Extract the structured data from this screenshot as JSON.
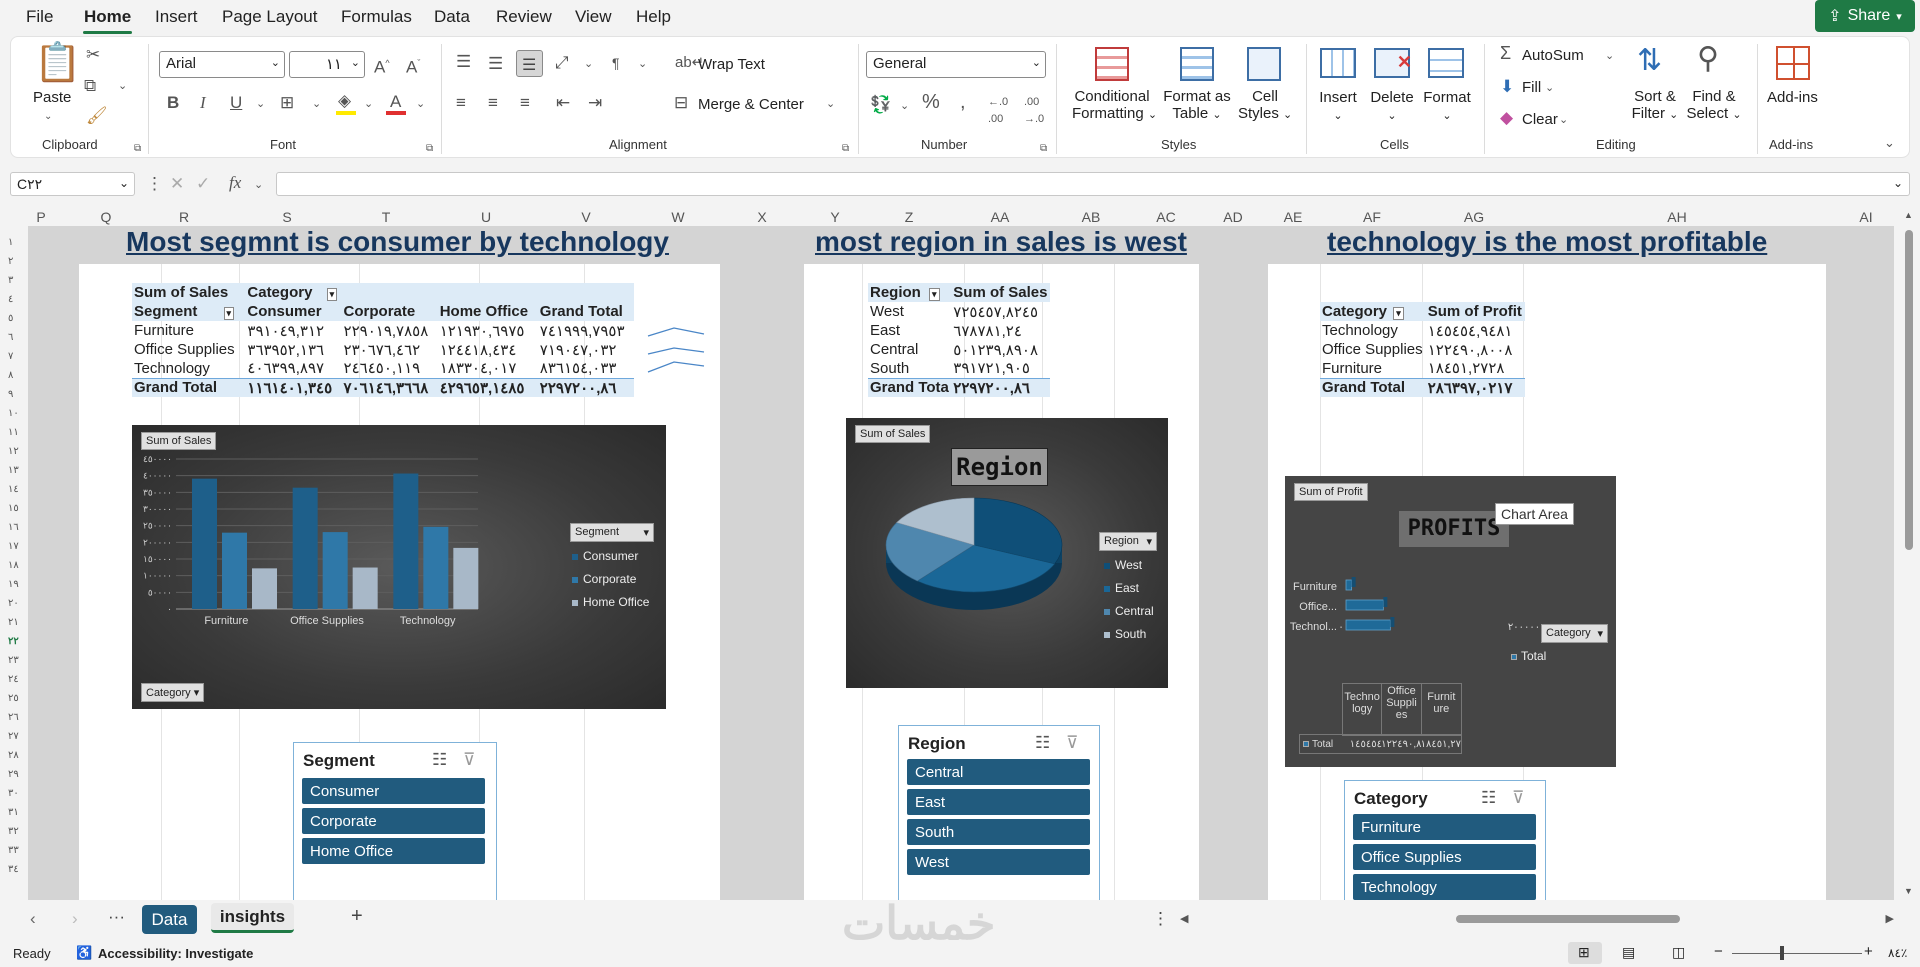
{
  "menu": {
    "tabs": [
      "File",
      "Home",
      "Insert",
      "Page Layout",
      "Formulas",
      "Data",
      "Review",
      "View",
      "Help"
    ],
    "active": "Home",
    "share": "Share"
  },
  "ribbon": {
    "clipboard": {
      "paste": "Paste",
      "label": "Clipboard"
    },
    "font": {
      "name": "Arial",
      "size": "١١",
      "label": "Font"
    },
    "alignment": {
      "wrap": "Wrap Text",
      "merge": "Merge & Center",
      "label": "Alignment"
    },
    "number": {
      "format": "General",
      "label": "Number"
    },
    "styles": {
      "conditional": [
        "Conditional",
        "Formatting"
      ],
      "format_table": [
        "Format as",
        "Table"
      ],
      "cell_styles": [
        "Cell",
        "Styles"
      ],
      "label": "Styles"
    },
    "cells": {
      "insert": "Insert",
      "delete": "Delete",
      "format": "Format",
      "label": "Cells"
    },
    "editing": {
      "autosum": "AutoSum",
      "fill": "Fill",
      "clear": "Clear",
      "sort": [
        "Sort &",
        "Filter"
      ],
      "find": [
        "Find &",
        "Select"
      ],
      "label": "Editing"
    },
    "addins": {
      "addins": "Add-ins",
      "label": "Add-ins"
    }
  },
  "formula_bar": {
    "name_box": "C٢٢",
    "fx": "fx",
    "value": ""
  },
  "columns": [
    "P",
    "Q",
    "R",
    "S",
    "T",
    "U",
    "V",
    "W",
    "X",
    "Y",
    "Z",
    "AA",
    "AB",
    "AC",
    "AD",
    "AE",
    "AF",
    "AG",
    "AH",
    "AI"
  ],
  "rows": [
    "١",
    "٢",
    "٣",
    "٤",
    "٥",
    "٦",
    "٧",
    "٨",
    "٩",
    "١٠",
    "١١",
    "١٢",
    "١٣",
    "١٤",
    "١٥",
    "١٦",
    "١٧",
    "١٨",
    "١٩",
    "٢٠",
    "٢١",
    "٢٢",
    "٢٣",
    "٢٤",
    "٢٥",
    "٢٦",
    "٢٧",
    "٢٨",
    "٢٩",
    "٣٠",
    "٣١",
    "٣٢",
    "٣٣",
    "٣٤"
  ],
  "panel1": {
    "title": "Most segmnt is consumer by technology",
    "pivot": {
      "corner": "Sum of Sales",
      "col_field": "Category",
      "row_field": "Segment",
      "headers": [
        "Consumer",
        "Corporate",
        "Home Office",
        "Grand Total"
      ],
      "rows": [
        {
          "label": "Furniture",
          "values": [
            "٣٩١٠٤٩,٣١٢",
            "٢٢٩٠١٩,٧٨٥٨",
            "١٢١٩٣٠,٦٩٧٥",
            "٧٤١٩٩٩,٧٩٥٣"
          ]
        },
        {
          "label": "Office Supplies",
          "values": [
            "٣٦٣٩٥٢,١٣٦",
            "٢٣٠٦٧٦,٤٦٢",
            "١٢٤٤١٨,٤٣٤",
            "٧١٩٠٤٧,٠٣٢"
          ]
        },
        {
          "label": "Technology",
          "values": [
            "٤٠٦٣٩٩,٨٩٧",
            "٢٤٦٤٥٠,١١٩",
            "١٨٣٣٠٤,٠١٧",
            "٨٣٦١٥٤,٠٣٣"
          ]
        }
      ],
      "total_label": "Grand Total",
      "totals": [
        "١١٦١٤٠١,٣٤٥",
        "٧٠٦١٤٦,٣٦٦٨",
        "٤٢٩٦٥٣,١٤٨٥",
        "٢٢٩٧٢٠٠,٨٦"
      ]
    },
    "chart": {
      "field_button": "Sum of Sales",
      "axis_button": "Category",
      "legend_button": "Segment",
      "legend": [
        "Consumer",
        "Corporate",
        "Home Office"
      ],
      "y_ticks": [
        "٤٥٠٠٠٠",
        "٤٠٠٠٠٠",
        "٣٥٠٠٠٠",
        "٣٠٠٠٠٠",
        "٢٥٠٠٠٠",
        "٢٠٠٠٠٠",
        "١٥٠٠٠٠",
        "١٠٠٠٠٠",
        "٥٠٠٠٠",
        "٠"
      ]
    },
    "slicer": {
      "title": "Segment",
      "items": [
        "Consumer",
        "Corporate",
        "Home Office"
      ]
    }
  },
  "panel2": {
    "title": "most region in sales is west",
    "pivot": {
      "h1": "Region",
      "h2": "Sum of Sales",
      "rows": [
        {
          "label": "West",
          "value": "٧٢٥٤٥٧,٨٢٤٥"
        },
        {
          "label": "East",
          "value": "٦٧٨٧٨١,٢٤"
        },
        {
          "label": "Central",
          "value": "٥٠١٢٣٩,٨٩٠٨"
        },
        {
          "label": "South",
          "value": "٣٩١٧٢١,٩٠٥"
        }
      ],
      "total_label": "Grand Tota",
      "total": "٢٢٩٧٢٠٠,٨٦"
    },
    "chart": {
      "field_button": "Sum of Sales",
      "title": "Region",
      "legend_button": "Region",
      "legend": [
        "West",
        "East",
        "Central",
        "South"
      ]
    },
    "slicer": {
      "title": "Region",
      "items": [
        "Central",
        "East",
        "South",
        "West"
      ]
    }
  },
  "panel3": {
    "title": "technology is the most profitable",
    "pivot": {
      "h1": "Category",
      "h2": "Sum of Profit",
      "rows": [
        {
          "label": "Technology",
          "value": "١٤٥٤٥٤,٩٤٨١"
        },
        {
          "label": "Office Supplies",
          "value": "١٢٢٤٩٠,٨٠٠٨"
        },
        {
          "label": "Furniture",
          "value": "١٨٤٥١,٢٧٢٨"
        }
      ],
      "total_label": "Grand Total",
      "total": "٢٨٦٣٩٧,٠٢١٧"
    },
    "chart": {
      "field_button": "Sum of Profit",
      "title": "PROFITS",
      "tooltip": "Chart Area",
      "categories": [
        "Furniture",
        "Office...",
        "Technol..."
      ],
      "x_ticks": [
        "٠",
        "٢٠٠٠٠٠"
      ],
      "legend_button": "Category",
      "legend": "Total",
      "table_headers": [
        "Techno logy",
        "Office Suppli es",
        "Furnit ure"
      ],
      "table_row_label": "Total",
      "table_values": [
        "١٤٥٤٥٤",
        "١٢٢٤٩٠,٨",
        "١٨٤٥١,٢٧"
      ]
    },
    "slicer": {
      "title": "Category",
      "items": [
        "Furniture",
        "Office Supplies",
        "Technology"
      ]
    }
  },
  "sheet_tabs": {
    "tabs": [
      "Data",
      "insights"
    ],
    "active": "insights"
  },
  "status": {
    "ready": "Ready",
    "accessibility": "Accessibility: Investigate",
    "zoom": "٨٤٪",
    "watermark": "خمسات"
  },
  "chart_data": [
    {
      "type": "bar",
      "title": "",
      "categories": [
        "Furniture",
        "Office Supplies",
        "Technology"
      ],
      "series": [
        {
          "name": "Consumer",
          "values": [
            391049.312,
            363952.136,
            406399.897
          ]
        },
        {
          "name": "Corporate",
          "values": [
            229019.7858,
            230676.462,
            246450.119
          ]
        },
        {
          "name": "Home Office",
          "values": [
            121930.6975,
            124418.434,
            183304.017
          ]
        }
      ],
      "ylim": [
        0,
        450000
      ],
      "legend": "right"
    },
    {
      "type": "pie",
      "title": "Region",
      "categories": [
        "West",
        "East",
        "Central",
        "South"
      ],
      "values": [
        725457.8245,
        678781.24,
        501239.8908,
        391721.905
      ],
      "legend": "right"
    },
    {
      "type": "bar",
      "title": "PROFITS",
      "orientation": "horizontal",
      "categories": [
        "Furniture",
        "Office Supplies",
        "Technology"
      ],
      "series": [
        {
          "name": "Total",
          "values": [
            18451.2728,
            122490.8008,
            145454.9481
          ]
        }
      ],
      "xlim": [
        0,
        400000
      ],
      "legend": "right"
    }
  ]
}
